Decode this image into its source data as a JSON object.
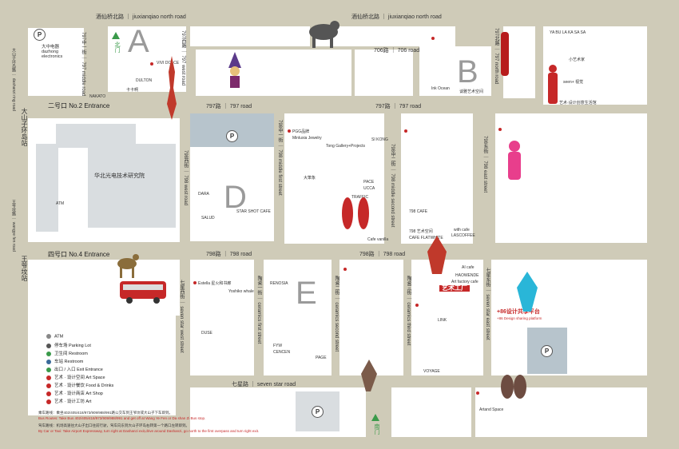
{
  "roads": {
    "north": "酒仙桥北路 ｜ jiuxianqiao north road",
    "north_right": "酒仙桥北路 ｜ jiuxianqiao north road",
    "road706": "706路 ｜ 706 road",
    "road797a": "797路 ｜ 797 road",
    "road797b": "797路 ｜ 797 road",
    "road798a": "798路 ｜ 798 road",
    "road798b": "798路 ｜ 798 road",
    "seven_star": "七星路 ｜ seven star road",
    "west797": "797西路 ｜ 797 west road",
    "middle797": "797中一街 ｜ 797 middle road",
    "west798": "798西街 ｜ 798 west road",
    "middle798_1": "798中一街 ｜ 798 middle first street",
    "middle798_2": "798中二街 ｜ 798 middle second street",
    "east798": "798东街 ｜ 798 east street",
    "north797": "797北路 ｜ 797 north road",
    "star_west": "七星西街 ｜ seven star west street",
    "ceramics_first": "陶瓷一街 ｜ ceramics first street",
    "ceramics_second": "陶瓷二街 ｜ ceramics second street",
    "ceramics_third": "陶瓷三街 ｜ ceramics third street",
    "star_east": "七星东街 ｜ seven star east street",
    "dashanzi_left": "大山子环岛路 ｜ dashanzi ring road",
    "wangye_left": "王爷坟路 ｜ wangye fen road"
  },
  "entrances": {
    "no2": "二号口 No.2 Entrance",
    "no4": "四号口 No.4 Entrance",
    "north_gate": "北门",
    "south_gate": "南门",
    "left_vertical": "大山子环岛站",
    "left_vertical2": "王爷坟站"
  },
  "zones": [
    "A",
    "B",
    "D",
    "E"
  ],
  "institute": "华北光电技术研究院",
  "dazhong": {
    "cn": "大中电器",
    "en1": "dazhong",
    "en2": "electronics"
  },
  "atm": "ATM",
  "parking": "P",
  "zone_labels": {
    "a": [
      "VIVI DOLCE",
      "DULTON",
      "卡卡啊",
      "NAKATO"
    ],
    "b": [
      "YA BU LA KA SA SA",
      "小艺术家",
      "seen+ 视觉",
      "艺术·设计创意生活馆",
      "Ink Ocean",
      "谈雅艺术空间"
    ],
    "center": [
      "PGG品牌",
      "Minluxia Jewelry",
      "Tong Gallery+Projects",
      "SI KONG",
      "大笨象",
      "PACE",
      "UCCA",
      "TRAFFIC",
      "Cafe vanilla",
      "798 艺术空间",
      "CAFE FLATWHITE",
      "LASCOFFEE",
      "with cafe",
      "798 CAFE"
    ],
    "d": [
      "DARA",
      "SALUD",
      "STAR SHOT CAFE"
    ],
    "e": [
      "Estella 星火和书廊",
      "Yoshiko whale",
      "RENOSIA",
      "DUSE",
      "CENCEN",
      "FYW",
      "PAGE",
      "VOYAGE",
      "LINK",
      "AI cafe",
      "HAOWENDE",
      "Art factory cafe",
      "Artand Space"
    ],
    "bottom_right": [
      "Artand Space"
    ]
  },
  "brand": {
    "yishu": "艺术工厂",
    "sharing": "+86设计共享平台",
    "sharing_en": "+86 Design sharing platform"
  },
  "legend": [
    {
      "icon": "atm-icon",
      "cn": "ATM",
      "en": ""
    },
    {
      "icon": "parking-icon",
      "cn": "停车场",
      "en": "Parking Lot"
    },
    {
      "icon": "restroom-icon",
      "cn": "卫生间",
      "en": "Restroom"
    },
    {
      "icon": "station-icon",
      "cn": "车站",
      "en": "Restroom"
    },
    {
      "icon": "exit-icon",
      "cn": "出口 / 入口",
      "en": "Exit  Entrance"
    },
    {
      "icon": "art-space-icon",
      "cn": "艺术 · 设计空间",
      "en": "Art Space"
    },
    {
      "icon": "food-icon",
      "cn": "艺术 · 设计餐饮",
      "en": "Food & Drinks"
    },
    {
      "icon": "shop-icon",
      "cn": "艺术 · 设计商店",
      "en": "Art Shop"
    },
    {
      "icon": "art-icon",
      "cn": "艺术 · 设计工坊",
      "en": "Art"
    }
  ],
  "footer": {
    "bus_cn": "乘车路线：乘坐402/405/418/973/909/988/991路公交车到王爷坟或大山子下车即到。",
    "bus_en": "Bus Routes: Take Bus 402/405/418/973/909/988/991 and get off at Wang Ye Fen or Da shan Zi Bus stop.",
    "car_cn": "驾车路线：机场高速往大山子出口往前行驶，驾车向东到大山子环岛右转第一个路口左转即到。",
    "car_en": "By Car or Taxi: Take Airport Expressway, turn right at Dashanzi exit,drive around Dashanzi, go north to the first overpass and turn right exit."
  },
  "colors": {
    "ground": "#cfcbb8",
    "block": "#ffffff",
    "accent_red": "#c62828",
    "arrow_green": "#3a9a4a"
  }
}
